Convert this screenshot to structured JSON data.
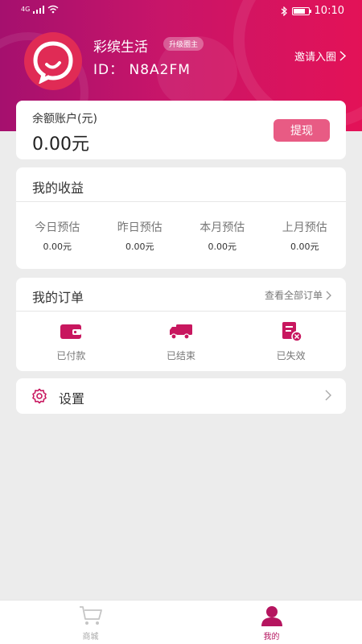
{
  "status_bar": {
    "network": "4G",
    "time": "10:10"
  },
  "profile": {
    "name": "彩缤生活",
    "badge": "升级圈主",
    "id_text": "ID： N8A2FM",
    "invite_label": "邀请入圈"
  },
  "balance": {
    "label": "余额账户(元)",
    "value": "0.00元",
    "withdraw_label": "提现"
  },
  "earnings": {
    "title": "我的收益",
    "items": [
      {
        "label": "今日预估",
        "value": "0.00元"
      },
      {
        "label": "昨日预估",
        "value": "0.00元"
      },
      {
        "label": "本月预估",
        "value": "0.00元"
      },
      {
        "label": "上月预估",
        "value": "0.00元"
      }
    ]
  },
  "orders": {
    "title": "我的订单",
    "view_all": "查看全部订单",
    "items": [
      {
        "label": "已付款",
        "icon": "wallet-icon"
      },
      {
        "label": "已结束",
        "icon": "truck-icon"
      },
      {
        "label": "已失效",
        "icon": "invalid-order-icon"
      }
    ]
  },
  "settings": {
    "label": "设置"
  },
  "tabbar": {
    "items": [
      {
        "label": "商城",
        "icon": "cart-icon",
        "active": false
      },
      {
        "label": "我的",
        "icon": "person-icon",
        "active": true
      }
    ]
  },
  "colors": {
    "primary": "#c8175f",
    "header_gradient_start": "#a5106e",
    "header_gradient_end": "#e31257",
    "button": "#e85b84",
    "background": "#ececec"
  }
}
